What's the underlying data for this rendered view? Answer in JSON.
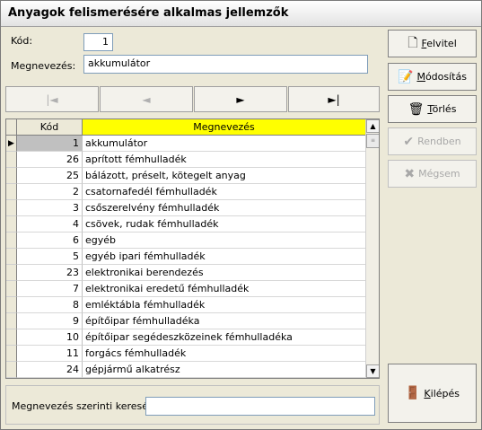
{
  "window": {
    "title": "Anyagok felismerésére alkalmas jellemzők"
  },
  "form": {
    "kod_label": "Kód:",
    "kod_value": "1",
    "megnevezes_label": "Megnevezés:",
    "megnevezes_value": "akkumulátor"
  },
  "nav": {
    "first": "|◄",
    "prev": "◄",
    "next": "►",
    "last": "►|"
  },
  "grid": {
    "columns": [
      "Kód",
      "Megnevezés"
    ],
    "rows": [
      {
        "kod": "1",
        "megnevezes": "akkumulátor"
      },
      {
        "kod": "26",
        "megnevezes": "aprított fémhulladék"
      },
      {
        "kod": "25",
        "megnevezes": "bálázott, préselt, kötegelt anyag"
      },
      {
        "kod": "2",
        "megnevezes": "csatornafedél fémhulladék"
      },
      {
        "kod": "3",
        "megnevezes": "csőszerelvény fémhulladék"
      },
      {
        "kod": "4",
        "megnevezes": "csövek, rudak fémhulladék"
      },
      {
        "kod": "6",
        "megnevezes": "egyéb"
      },
      {
        "kod": "5",
        "megnevezes": "egyéb ipari fémhulladék"
      },
      {
        "kod": "23",
        "megnevezes": "elektronikai berendezés"
      },
      {
        "kod": "7",
        "megnevezes": "elektronikai eredetű fémhulladék"
      },
      {
        "kod": "8",
        "megnevezes": "emléktábla fémhulladék"
      },
      {
        "kod": "9",
        "megnevezes": "építőipar fémhulladéka"
      },
      {
        "kod": "10",
        "megnevezes": "építőipar segédeszközeinek fémhulladéka"
      },
      {
        "kod": "11",
        "megnevezes": "forgács fémhulladék"
      },
      {
        "kod": "24",
        "megnevezes": "gépjármű alkatrész"
      }
    ]
  },
  "search": {
    "label": "Megnevezés szerinti keresés",
    "value": ""
  },
  "buttons": {
    "felvitel": {
      "first": "F",
      "rest": "elvitel"
    },
    "modositas": {
      "first": "M",
      "rest": "ódosítás"
    },
    "torles": {
      "first": "T",
      "rest": "örlés"
    },
    "rendben": "Rendben",
    "megsem": "Mégsem",
    "kilepes": {
      "first": "K",
      "rest": "ilépés"
    }
  },
  "colors": {
    "header_highlight": "#ffff00",
    "window_bg": "#ece9d8"
  }
}
